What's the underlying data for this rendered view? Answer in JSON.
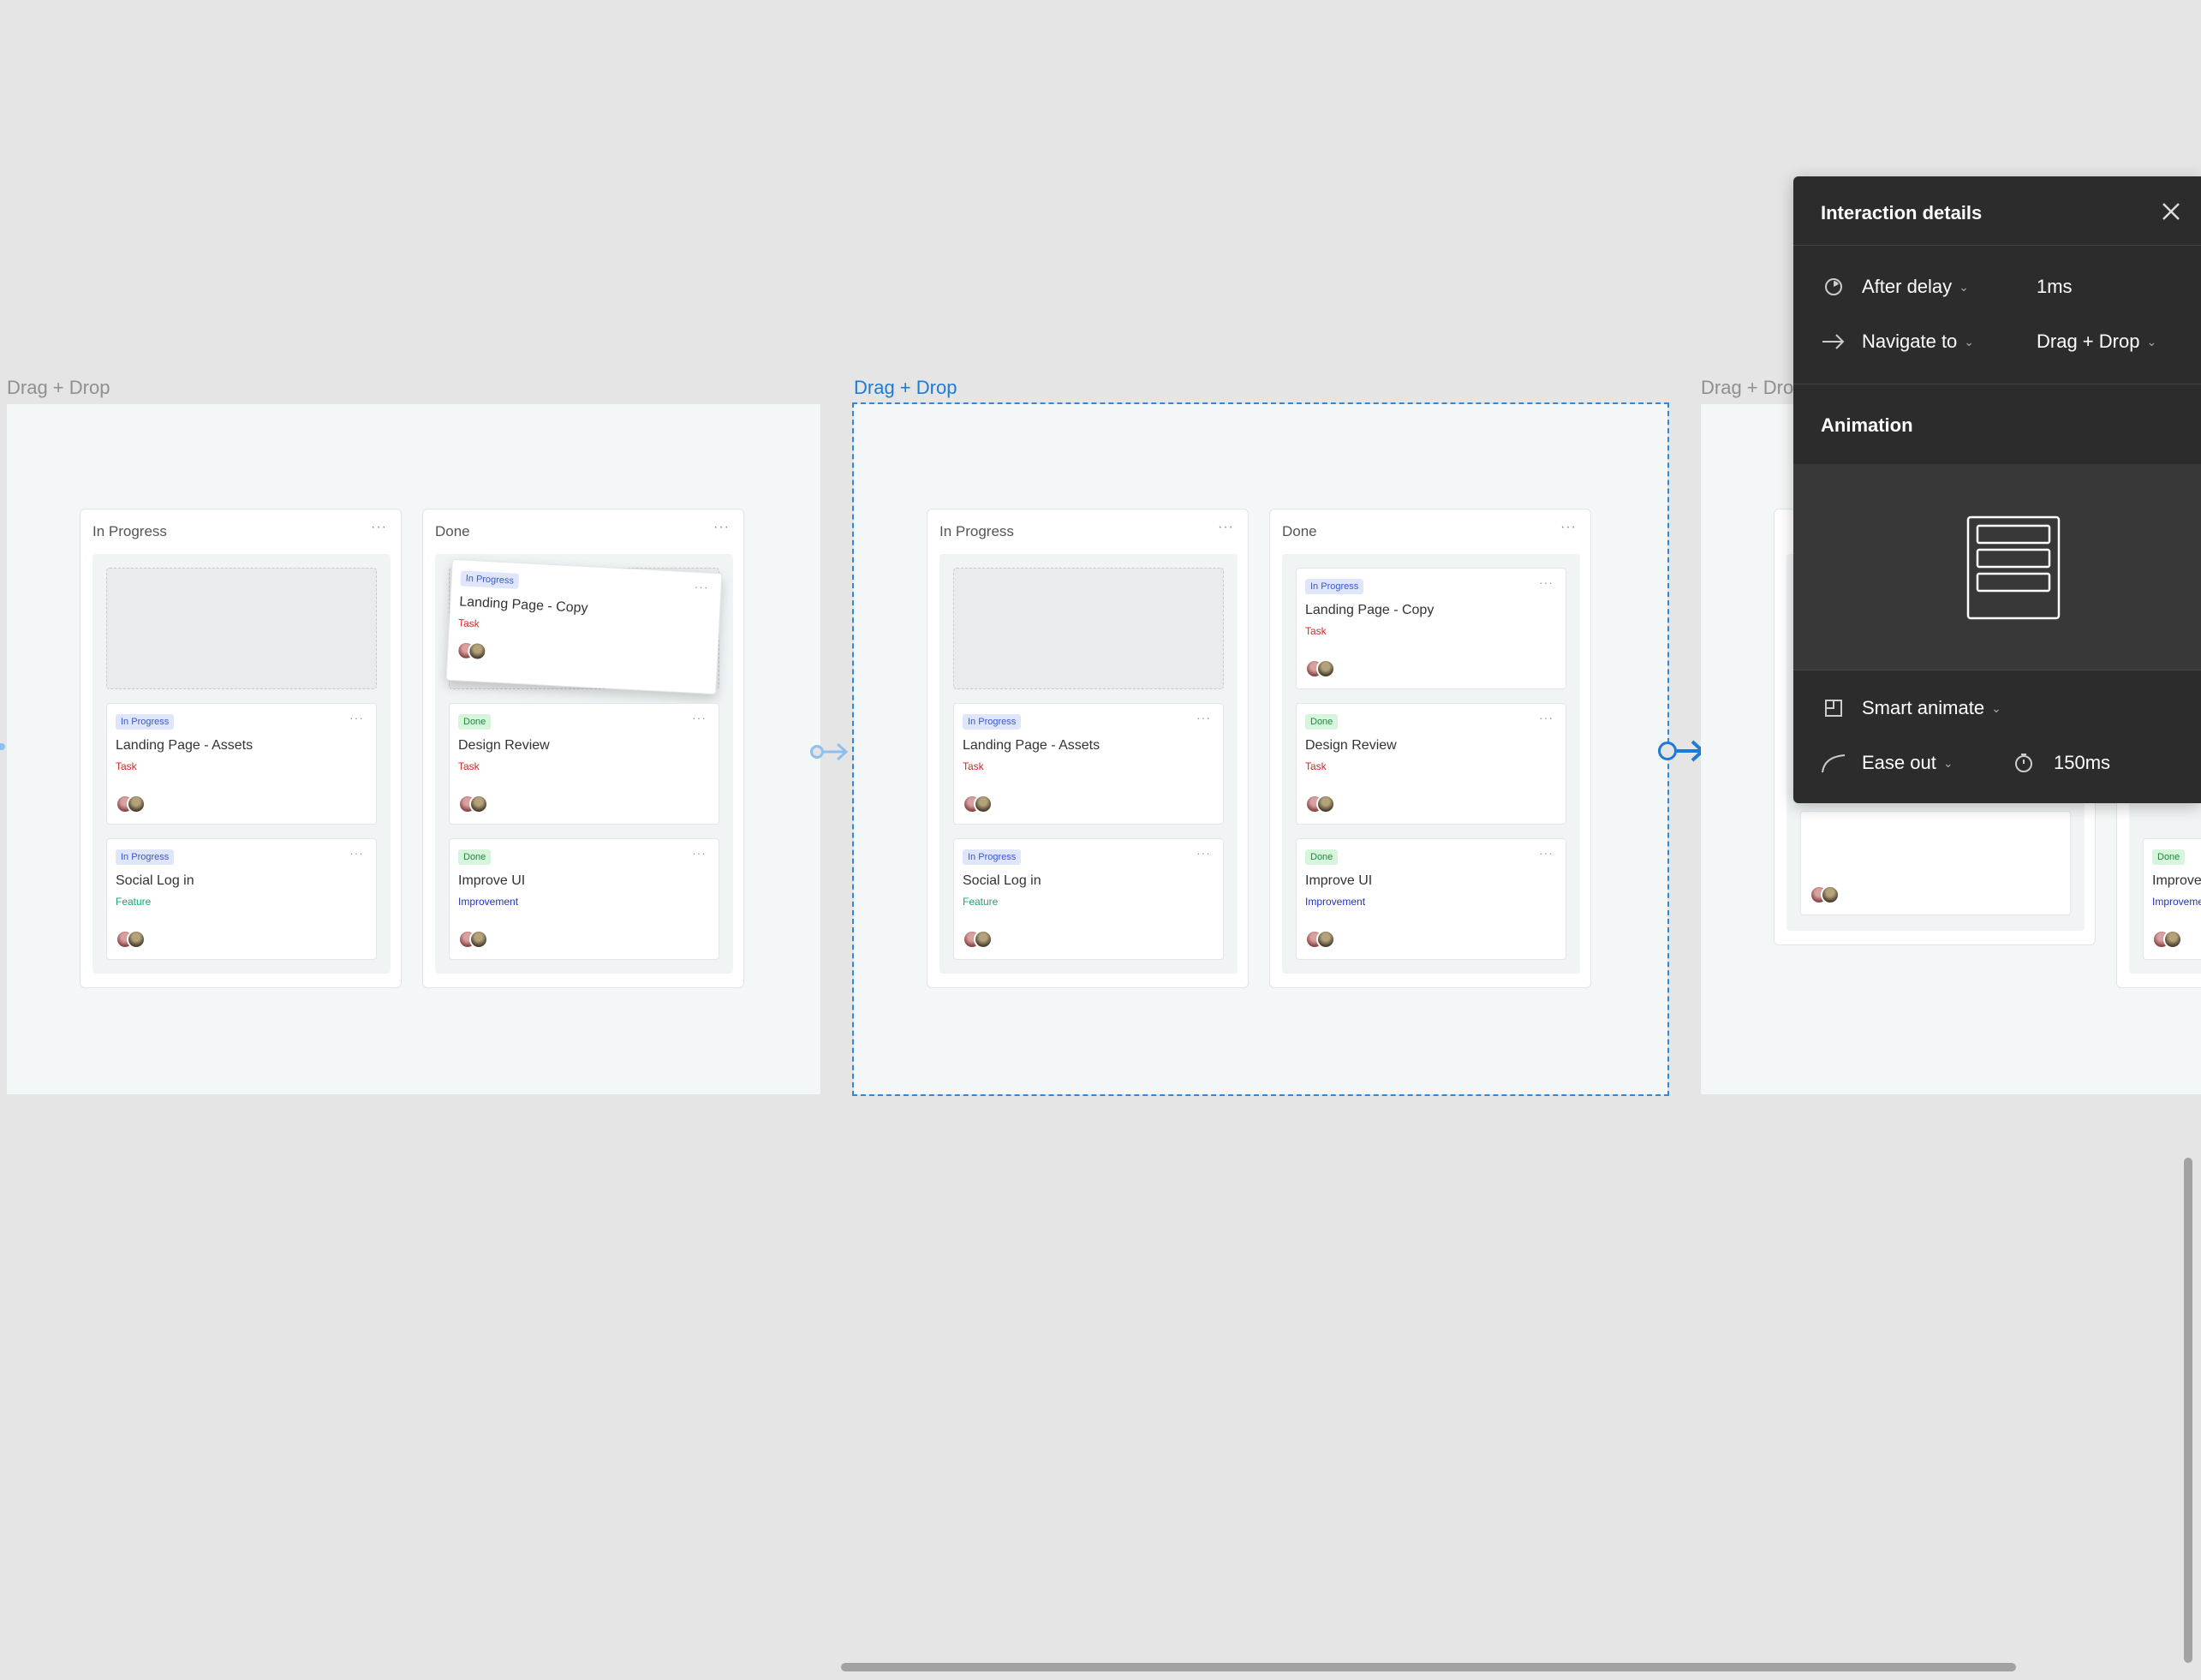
{
  "frames": [
    {
      "label": "Drag + Drop"
    },
    {
      "label": "Drag + Drop"
    },
    {
      "label": "Drag + Dro"
    }
  ],
  "board": {
    "columns": [
      "In Progress",
      "Done"
    ],
    "menu_glyph": "···"
  },
  "cards": {
    "landing_assets": {
      "badge": "In Progress",
      "title": "Landing Page - Assets",
      "tag": "Task"
    },
    "social_login": {
      "badge": "In Progress",
      "title": "Social Log in",
      "tag": "Feature"
    },
    "landing_copy": {
      "badge": "In Progress",
      "title": "Landing Page - Copy",
      "tag": "Task"
    },
    "design_review": {
      "badge": "Done",
      "title": "Design Review",
      "tag": "Task"
    },
    "improve_ui": {
      "badge": "Done",
      "title": "Improve UI",
      "tag": "Improvement"
    }
  },
  "panel": {
    "title": "Interaction details",
    "trigger": "After delay",
    "delay": "1ms",
    "action": "Navigate to",
    "destination": "Drag + Drop",
    "animation_heading": "Animation",
    "animation_type": "Smart animate",
    "easing": "Ease out",
    "duration": "150ms"
  },
  "colors": {
    "canvas": "#e5e5e5",
    "frame": "#f4f7f7",
    "selection": "#2e88e0",
    "panel": "#2c2c2c"
  }
}
